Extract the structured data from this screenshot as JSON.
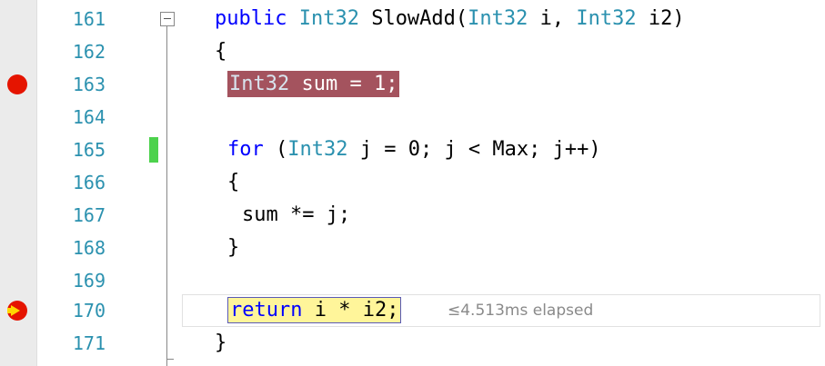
{
  "editor": {
    "lines": [
      {
        "num": "161",
        "parts": [
          "public ",
          "Int32",
          " SlowAdd(",
          "Int32",
          " i, ",
          "Int32",
          " i2)"
        ]
      },
      {
        "num": "162",
        "text": "{"
      },
      {
        "num": "163",
        "parts": [
          "Int32",
          " sum = 1;"
        ],
        "breakpoint": true
      },
      {
        "num": "164",
        "text": ""
      },
      {
        "num": "165",
        "parts": [
          "for",
          " (",
          "Int32",
          " j = 0; j < Max; j++)"
        ],
        "changed": true
      },
      {
        "num": "166",
        "text": "{"
      },
      {
        "num": "167",
        "text": "sum *= j;"
      },
      {
        "num": "168",
        "text": "}"
      },
      {
        "num": "169",
        "text": ""
      },
      {
        "num": "170",
        "parts": [
          "return",
          " i * i2;"
        ],
        "current_statement": true,
        "perftip": "≤4.513ms elapsed"
      },
      {
        "num": "171",
        "text": "}"
      }
    ]
  },
  "colors": {
    "keyword": "#0000ff",
    "type": "#2b91af",
    "line_number": "#2b91af",
    "breakpoint_glyph": "#e51400",
    "breakpoint_highlight": "#a4535e",
    "current_statement_highlight": "#fff59a",
    "changed_line_bar": "#4dd24d"
  },
  "icons": {
    "breakpoint": "breakpoint-icon",
    "current_statement": "current-statement-icon",
    "collapse": "collapse-icon"
  }
}
